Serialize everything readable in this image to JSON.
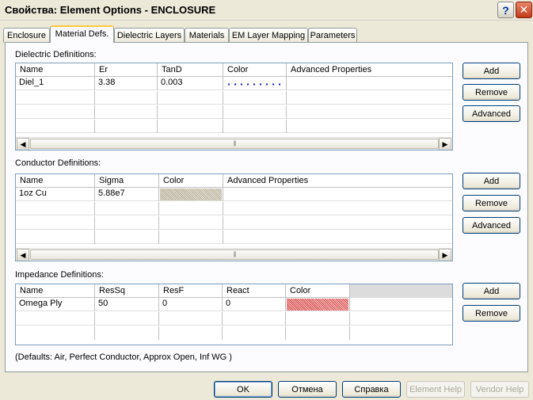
{
  "window": {
    "title": "Свойства: Element Options - ENCLOSURE",
    "help_glyph": "?",
    "close_glyph": "✕"
  },
  "tabs": [
    {
      "label": "Enclosure",
      "active": false
    },
    {
      "label": "Material Defs.",
      "active": true
    },
    {
      "label": "Dielectric Layers",
      "active": false
    },
    {
      "label": "Materials",
      "active": false
    },
    {
      "label": "EM Layer Mapping",
      "active": false
    },
    {
      "label": "Parameters",
      "active": false
    }
  ],
  "dielectric": {
    "label": "Dielectric Definitions:",
    "columns": [
      "Name",
      "Er",
      "TanD",
      "Color",
      "Advanced Properties"
    ],
    "rows": [
      {
        "name": "Diel_1",
        "er": "3.38",
        "tand": "0.003",
        "color": "#1515c8",
        "color_pattern": "dots"
      }
    ],
    "buttons": {
      "add": "Add",
      "remove": "Remove",
      "advanced": "Advanced"
    }
  },
  "conductor": {
    "label": "Conductor Definitions:",
    "columns": [
      "Name",
      "Sigma",
      "Color",
      "Advanced Properties"
    ],
    "rows": [
      {
        "name": "1oz Cu",
        "sigma": "5.88e7",
        "color": "#b3ac98",
        "color_pattern": "stipple"
      }
    ],
    "buttons": {
      "add": "Add",
      "remove": "Remove",
      "advanced": "Advanced"
    }
  },
  "impedance": {
    "label": "Impedance Definitions:",
    "columns": [
      "Name",
      "ResSq",
      "ResF",
      "React",
      "Color"
    ],
    "rows": [
      {
        "name": "Omega Ply",
        "ressq": "50",
        "resf": "0",
        "react": "0",
        "color": "#d84a4a",
        "color_pattern": "stipple"
      }
    ],
    "buttons": {
      "add": "Add",
      "remove": "Remove"
    }
  },
  "scrollbar": {
    "left_arrow": "◀",
    "right_arrow": "▶",
    "grip": "|||"
  },
  "defaults_text": "(Defaults:  Air, Perfect Conductor, Approx Open, Inf WG  )",
  "footer": {
    "ok": "OK",
    "cancel": "Отмена",
    "help": "Справка",
    "element_help": "Element Help",
    "vendor_help": "Vendor Help"
  }
}
